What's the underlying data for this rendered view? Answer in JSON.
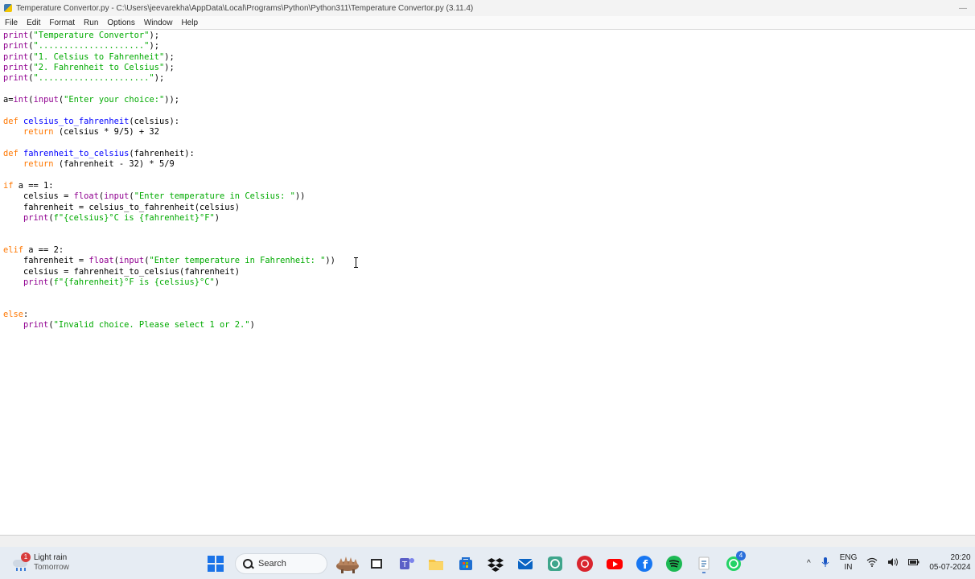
{
  "window": {
    "title": "Temperature Convertor.py - C:\\Users\\jeevarekha\\AppData\\Local\\Programs\\Python\\Python311\\Temperature Convertor.py (3.11.4)",
    "minimize_glyph": "—"
  },
  "menu": {
    "items": [
      "File",
      "Edit",
      "Format",
      "Run",
      "Options",
      "Window",
      "Help"
    ]
  },
  "editor": {
    "lines": [
      [
        [
          "bi",
          "print"
        ],
        [
          "",
          "("
        ],
        [
          "str",
          "\"Temperature Convertor\""
        ],
        [
          "",
          ");"
        ]
      ],
      [
        [
          "bi",
          "print"
        ],
        [
          "",
          "("
        ],
        [
          "str",
          "\".....................\""
        ],
        [
          "",
          ");"
        ]
      ],
      [
        [
          "bi",
          "print"
        ],
        [
          "",
          "("
        ],
        [
          "str",
          "\"1. Celsius to Fahrenheit\""
        ],
        [
          "",
          ");"
        ]
      ],
      [
        [
          "bi",
          "print"
        ],
        [
          "",
          "("
        ],
        [
          "str",
          "\"2. Fahrenheit to Celsius\""
        ],
        [
          "",
          ");"
        ]
      ],
      [
        [
          "bi",
          "print"
        ],
        [
          "",
          "("
        ],
        [
          "str",
          "\"......................\""
        ],
        [
          "",
          ");"
        ]
      ],
      [],
      [
        [
          "",
          "a="
        ],
        [
          "bi",
          "int"
        ],
        [
          "",
          "("
        ],
        [
          "bi",
          "input"
        ],
        [
          "",
          "("
        ],
        [
          "str",
          "\"Enter your choice:\""
        ],
        [
          "",
          "));"
        ]
      ],
      [],
      [
        [
          "kw",
          "def"
        ],
        [
          "",
          " "
        ],
        [
          "def",
          "celsius_to_fahrenheit"
        ],
        [
          "",
          "(celsius):"
        ]
      ],
      [
        [
          "",
          "    "
        ],
        [
          "kw",
          "return"
        ],
        [
          "",
          " (celsius * 9/5) + 32"
        ]
      ],
      [],
      [
        [
          "kw",
          "def"
        ],
        [
          "",
          " "
        ],
        [
          "def",
          "fahrenheit_to_celsius"
        ],
        [
          "",
          "(fahrenheit):"
        ]
      ],
      [
        [
          "",
          "    "
        ],
        [
          "kw",
          "return"
        ],
        [
          "",
          " (fahrenheit - 32) * 5/9"
        ]
      ],
      [],
      [
        [
          "kw",
          "if"
        ],
        [
          "",
          " a == 1:"
        ]
      ],
      [
        [
          "",
          "    celsius = "
        ],
        [
          "bi",
          "float"
        ],
        [
          "",
          "("
        ],
        [
          "bi",
          "input"
        ],
        [
          "",
          "("
        ],
        [
          "str",
          "\"Enter temperature in Celsius: \""
        ],
        [
          "",
          "))"
        ]
      ],
      [
        [
          "",
          "    fahrenheit = celsius_to_fahrenheit(celsius)"
        ]
      ],
      [
        [
          "",
          "    "
        ],
        [
          "bi",
          "print"
        ],
        [
          "",
          "("
        ],
        [
          "str",
          "f\"{celsius}°C is {fahrenheit}°F\""
        ],
        [
          "",
          ")"
        ]
      ],
      [],
      [],
      [
        [
          "kw",
          "elif"
        ],
        [
          "",
          " a == 2:"
        ]
      ],
      [
        [
          "",
          "    fahrenheit = "
        ],
        [
          "bi",
          "float"
        ],
        [
          "",
          "("
        ],
        [
          "bi",
          "input"
        ],
        [
          "",
          "("
        ],
        [
          "str",
          "\"Enter temperature in Fahrenheit: \""
        ],
        [
          "",
          "))"
        ]
      ],
      [
        [
          "",
          "    celsius = fahrenheit_to_celsius(fahrenheit)"
        ]
      ],
      [
        [
          "",
          "    "
        ],
        [
          "bi",
          "print"
        ],
        [
          "",
          "("
        ],
        [
          "str",
          "f\"{fahrenheit}°F is {celsius}°C\""
        ],
        [
          "",
          ")"
        ]
      ],
      [],
      [],
      [
        [
          "kw",
          "else"
        ],
        [
          "",
          ":"
        ]
      ],
      [
        [
          "",
          "    "
        ],
        [
          "bi",
          "print"
        ],
        [
          "",
          "("
        ],
        [
          "str",
          "\"Invalid choice. Please select 1 or 2.\""
        ],
        [
          "",
          ")"
        ]
      ]
    ]
  },
  "taskbar": {
    "weather_badge": "1",
    "weather_title": "Light rain",
    "weather_sub": "Tomorrow",
    "search_label": "Search",
    "teams_badge": "4",
    "lang_top": "ENG",
    "lang_bottom": "IN",
    "time": "20:20",
    "date": "05-07-2024",
    "tray_chevron": "^"
  },
  "colors": {
    "keyword": "#ff7700",
    "builtin": "#900090",
    "string": "#00aa00",
    "definition": "#0000ff",
    "taskbar": "#e6ecf3"
  }
}
